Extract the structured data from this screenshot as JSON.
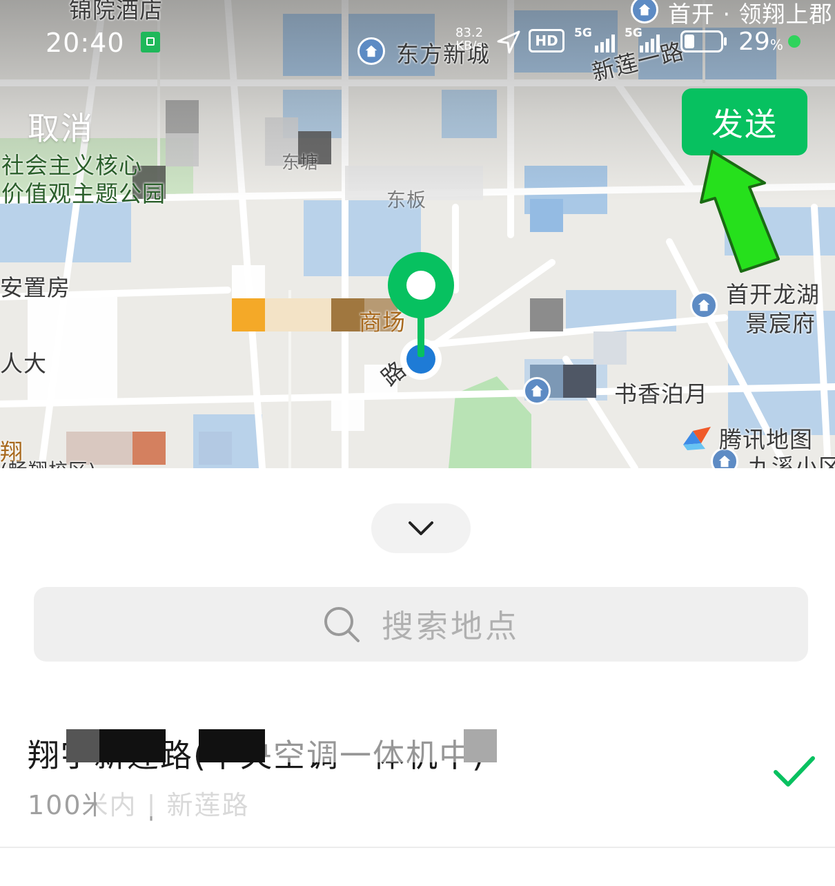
{
  "status_bar": {
    "time": "20:40",
    "net_speed_value": "83.2",
    "net_speed_unit": "KB/s",
    "hd_label": "HD",
    "sim1_label": "5G",
    "sim2_label": "5G",
    "battery_percent": "29",
    "battery_unit": "%",
    "battery_level": 0.29
  },
  "header": {
    "cancel_label": "取消",
    "send_label": "发送"
  },
  "map": {
    "labels": {
      "jinyuan_hotel": "锦院酒店",
      "dongfang_xincheng": "东方新城",
      "shoukai_lingxiang": "首开 · 领翔上郡",
      "xinlian_road": "新莲一路",
      "core_values_1": "社会主义核心",
      "core_values_2": "价值观主题公园",
      "dongyuan": "东塘",
      "dongban": "东板",
      "anzhifang": "安置房",
      "market": "商场",
      "road": "路",
      "ren": "人大",
      "shoukai_longhu_1": "首开龙湖",
      "shoukai_longhu_2": "景宸府",
      "shuxiang": "书香泊月",
      "xiang_left": "翔",
      "xiang_sub": "(畅翔校区)",
      "jiuxi": "九溪小区"
    },
    "brand": "腾讯地图",
    "accent_color": "#07c160",
    "user_dot_color": "#1e7bd6"
  },
  "sheet": {
    "collapse_icon": "chevron-down-icon",
    "search_placeholder": "搜索地点",
    "result": {
      "name": "翔宇新莲路(中央空调一体机中)",
      "address": "100米内 | 新莲路",
      "selected": true
    }
  }
}
